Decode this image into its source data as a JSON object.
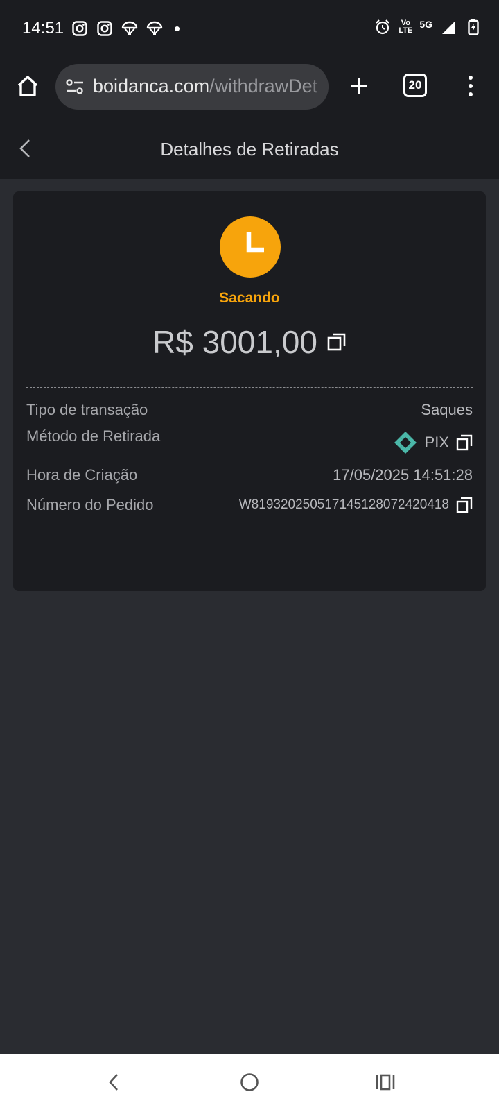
{
  "status_bar": {
    "time": "14:51",
    "left_icons": [
      "instagram-icon",
      "instagram-icon",
      "parachute-icon",
      "parachute-icon",
      "dot"
    ],
    "volte_top": "Vo",
    "volte_bottom": "LTE",
    "network": "5G"
  },
  "browser": {
    "url_host": "boidanca.com",
    "url_path": "/withdrawDet",
    "tab_count": "20"
  },
  "header": {
    "title": "Detalhes de Retiradas"
  },
  "withdrawal": {
    "status": "Sacando",
    "status_color": "#f7a40c",
    "amount": "R$ 3001,00",
    "rows": [
      {
        "label": "Tipo de transação",
        "value": "Saques"
      },
      {
        "label": "Método de Retirada",
        "value": "PIX",
        "icon": "pix-icon"
      },
      {
        "label": "Hora de Criação",
        "value": "17/05/2025 14:51:28"
      },
      {
        "label": "Número do Pedido",
        "value": "W819320250517145128072420418"
      }
    ]
  },
  "colors": {
    "background": "#2a2c31",
    "card": "#1b1c20",
    "accent": "#f7a40c",
    "pix": "#4bb8a9"
  }
}
